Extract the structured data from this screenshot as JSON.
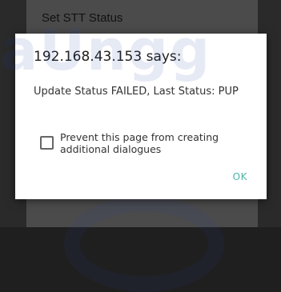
{
  "page": {
    "title": "Set STT Status"
  },
  "watermark": {
    "text": "aUngg"
  },
  "dialog": {
    "title": "192.168.43.153 says:",
    "message": "Update Status FAILED, Last Status: PUP",
    "prevent_checkbox": {
      "label": "Prevent this page from creating additional dialogues",
      "checked": false
    },
    "ok_label": "OK"
  },
  "colors": {
    "accent": "#4db6ac",
    "dialog_bg": "#ffffff",
    "backdrop": "#2a2a2a"
  }
}
